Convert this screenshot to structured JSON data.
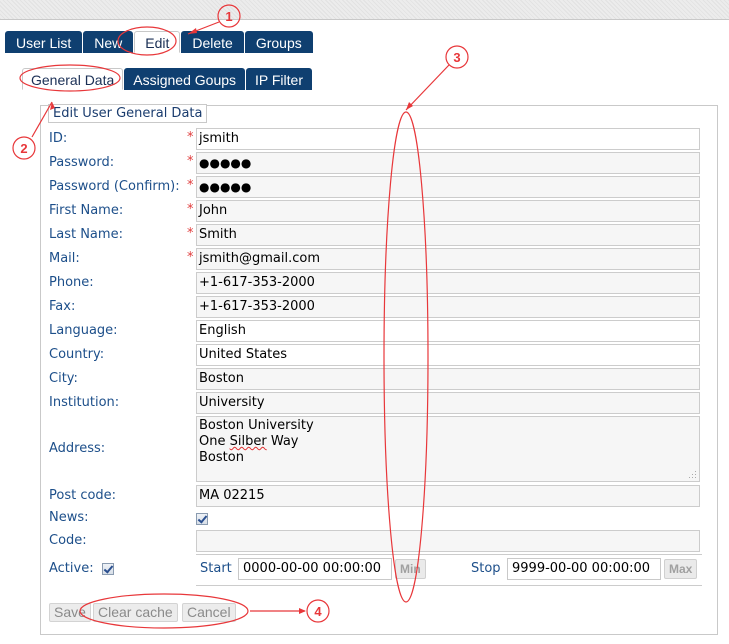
{
  "main_tabs": [
    {
      "label": "User List",
      "active": false
    },
    {
      "label": "New",
      "active": false
    },
    {
      "label": "Edit",
      "active": true
    },
    {
      "label": "Delete",
      "active": false
    },
    {
      "label": "Groups",
      "active": false
    }
  ],
  "sub_tabs": [
    {
      "label": "General Data",
      "active": true
    },
    {
      "label": "Assigned Goups",
      "active": false
    },
    {
      "label": "IP Filter",
      "active": false
    }
  ],
  "form": {
    "legend": "Edit User General Data",
    "required_mark": "*",
    "fields": {
      "id": {
        "label": "ID:",
        "value": "jsmith",
        "required": true
      },
      "password": {
        "label": "Password:",
        "value": "●●●●●",
        "required": true
      },
      "password_confirm": {
        "label": "Password (Confirm):",
        "value": "●●●●●",
        "required": true
      },
      "first_name": {
        "label": "First Name:",
        "value": "John",
        "required": true
      },
      "last_name": {
        "label": "Last Name:",
        "value": "Smith",
        "required": true
      },
      "mail": {
        "label": "Mail:",
        "value": "jsmith@gmail.com",
        "required": true
      },
      "phone": {
        "label": "Phone:",
        "value": "+1-617-353-2000",
        "required": false
      },
      "fax": {
        "label": "Fax:",
        "value": "+1-617-353-2000",
        "required": false
      },
      "language": {
        "label": "Language:",
        "value": "English",
        "required": false
      },
      "country": {
        "label": "Country:",
        "value": "United States",
        "required": false
      },
      "city": {
        "label": "City:",
        "value": "Boston",
        "required": false
      },
      "institution": {
        "label": "Institution:",
        "value": "University",
        "required": false
      },
      "address": {
        "label": "Address:",
        "line1": "Boston University",
        "line2_pre": "One ",
        "line2_misspelled": "Silber",
        "line2_post": " Way",
        "line3": "Boston",
        "required": false
      },
      "post_code": {
        "label": "Post code:",
        "value": "MA 02215",
        "required": false
      },
      "news": {
        "label": "News:",
        "checked": true
      },
      "code": {
        "label": "Code:",
        "value": ""
      },
      "active": {
        "label": "Active:",
        "checked": true
      }
    },
    "start": {
      "label": "Start",
      "value": "0000-00-00 00:00:00",
      "button": "Min"
    },
    "stop": {
      "label": "Stop",
      "value": "9999-00-00 00:00:00",
      "button": "Max"
    }
  },
  "buttons": {
    "save": "Save",
    "clear_cache": "Clear cache",
    "cancel": "Cancel"
  },
  "annotations": {
    "color": "#e8373a",
    "markers": [
      "1",
      "2",
      "3",
      "4"
    ]
  }
}
